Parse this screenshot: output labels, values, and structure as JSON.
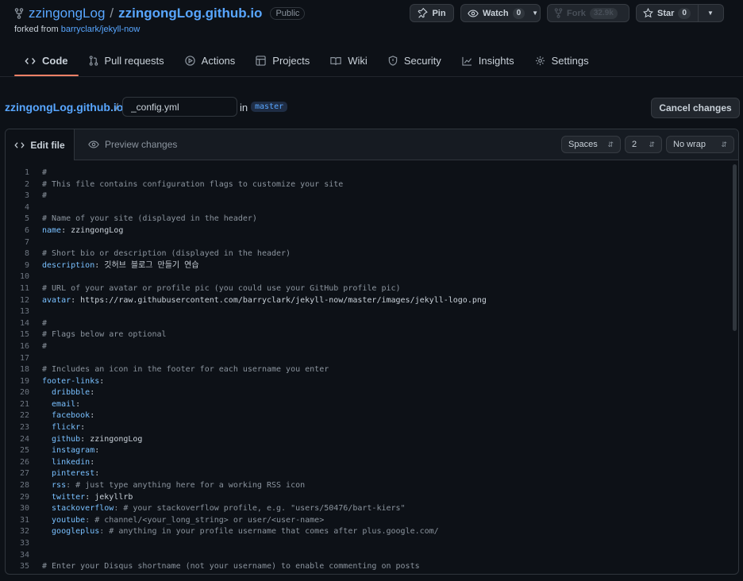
{
  "repo": {
    "owner": "zzingongLog",
    "name": "zzingongLog.github.io",
    "visibility": "Public",
    "forked_prefix": "forked from",
    "forked_source": "barryclark/jekyll-now"
  },
  "actions": {
    "pin": "Pin",
    "watch": "Watch",
    "watch_count": "0",
    "fork": "Fork",
    "fork_count": "32.9k",
    "star": "Star",
    "star_count": "0"
  },
  "tabs": [
    {
      "label": "Code",
      "icon": "code-icon"
    },
    {
      "label": "Pull requests",
      "icon": "git-pull-request-icon"
    },
    {
      "label": "Actions",
      "icon": "play-icon"
    },
    {
      "label": "Projects",
      "icon": "table-icon"
    },
    {
      "label": "Wiki",
      "icon": "book-icon"
    },
    {
      "label": "Security",
      "icon": "shield-icon"
    },
    {
      "label": "Insights",
      "icon": "graph-icon"
    },
    {
      "label": "Settings",
      "icon": "gear-icon"
    }
  ],
  "path": {
    "repo_link": "zzingongLog.github.io",
    "separator": "/",
    "filename": "_config.yml",
    "in_label": "in",
    "branch": "master",
    "cancel": "Cancel changes"
  },
  "editor": {
    "edit_tab": "Edit file",
    "preview_tab": "Preview changes",
    "indent_mode": "Spaces",
    "indent_size": "2",
    "wrap_mode": "No wrap",
    "lines": [
      {
        "n": "1",
        "parts": [
          {
            "t": "#",
            "c": "comment"
          }
        ]
      },
      {
        "n": "2",
        "parts": [
          {
            "t": "# This file contains configuration flags to customize your site",
            "c": "comment"
          }
        ]
      },
      {
        "n": "3",
        "parts": [
          {
            "t": "#",
            "c": "comment"
          }
        ]
      },
      {
        "n": "4",
        "parts": []
      },
      {
        "n": "5",
        "parts": [
          {
            "t": "# Name of your site (displayed in the header)",
            "c": "comment"
          }
        ]
      },
      {
        "n": "6",
        "parts": [
          {
            "t": "name",
            "c": "key"
          },
          {
            "t": ": zzingongLog",
            "c": "txt"
          }
        ]
      },
      {
        "n": "7",
        "parts": []
      },
      {
        "n": "8",
        "parts": [
          {
            "t": "# Short bio or description (displayed in the header)",
            "c": "comment"
          }
        ]
      },
      {
        "n": "9",
        "parts": [
          {
            "t": "description",
            "c": "key"
          },
          {
            "t": ": 깃허브 블로그 만들기 연습",
            "c": "txt"
          }
        ]
      },
      {
        "n": "10",
        "parts": []
      },
      {
        "n": "11",
        "parts": [
          {
            "t": "# URL of your avatar or profile pic (you could use your GitHub profile pic)",
            "c": "comment"
          }
        ]
      },
      {
        "n": "12",
        "parts": [
          {
            "t": "avatar",
            "c": "key"
          },
          {
            "t": ": https://raw.githubusercontent.com/barryclark/jekyll-now/master/images/jekyll-logo.png",
            "c": "txt"
          }
        ]
      },
      {
        "n": "13",
        "parts": []
      },
      {
        "n": "14",
        "parts": [
          {
            "t": "#",
            "c": "comment"
          }
        ]
      },
      {
        "n": "15",
        "parts": [
          {
            "t": "# Flags below are optional",
            "c": "comment"
          }
        ]
      },
      {
        "n": "16",
        "parts": [
          {
            "t": "#",
            "c": "comment"
          }
        ]
      },
      {
        "n": "17",
        "parts": []
      },
      {
        "n": "18",
        "parts": [
          {
            "t": "# Includes an icon in the footer for each username you enter",
            "c": "comment"
          }
        ]
      },
      {
        "n": "19",
        "parts": [
          {
            "t": "footer-links",
            "c": "key"
          },
          {
            "t": ":",
            "c": "txt"
          }
        ]
      },
      {
        "n": "20",
        "parts": [
          {
            "t": "  dribbble",
            "c": "key"
          },
          {
            "t": ":",
            "c": "txt"
          }
        ]
      },
      {
        "n": "21",
        "parts": [
          {
            "t": "  email",
            "c": "key"
          },
          {
            "t": ":",
            "c": "txt"
          }
        ]
      },
      {
        "n": "22",
        "parts": [
          {
            "t": "  facebook",
            "c": "key"
          },
          {
            "t": ":",
            "c": "txt"
          }
        ]
      },
      {
        "n": "23",
        "parts": [
          {
            "t": "  flickr",
            "c": "key"
          },
          {
            "t": ":",
            "c": "txt"
          }
        ]
      },
      {
        "n": "24",
        "parts": [
          {
            "t": "  github",
            "c": "key"
          },
          {
            "t": ": zzingongLog",
            "c": "txt"
          }
        ]
      },
      {
        "n": "25",
        "parts": [
          {
            "t": "  instagram",
            "c": "key"
          },
          {
            "t": ":",
            "c": "txt"
          }
        ]
      },
      {
        "n": "26",
        "parts": [
          {
            "t": "  linkedin",
            "c": "key"
          },
          {
            "t": ":",
            "c": "txt"
          }
        ]
      },
      {
        "n": "27",
        "parts": [
          {
            "t": "  pinterest",
            "c": "key"
          },
          {
            "t": ":",
            "c": "txt"
          }
        ]
      },
      {
        "n": "28",
        "parts": [
          {
            "t": "  rss",
            "c": "key"
          },
          {
            "t": ": # just type anything here for a working RSS icon",
            "c": "comment"
          }
        ]
      },
      {
        "n": "29",
        "parts": [
          {
            "t": "  twitter",
            "c": "key"
          },
          {
            "t": ": jekyllrb",
            "c": "txt"
          }
        ]
      },
      {
        "n": "30",
        "parts": [
          {
            "t": "  stackoverflow",
            "c": "key"
          },
          {
            "t": ": # your stackoverflow profile, e.g. \"users/50476/bart-kiers\"",
            "c": "comment"
          }
        ]
      },
      {
        "n": "31",
        "parts": [
          {
            "t": "  youtube",
            "c": "key"
          },
          {
            "t": ": # channel/<your_long_string> or user/<user-name>",
            "c": "comment"
          }
        ]
      },
      {
        "n": "32",
        "parts": [
          {
            "t": "  googleplus",
            "c": "key"
          },
          {
            "t": ": # anything in your profile username that comes after plus.google.com/",
            "c": "comment"
          }
        ]
      },
      {
        "n": "33",
        "parts": []
      },
      {
        "n": "34",
        "parts": []
      },
      {
        "n": "35",
        "parts": [
          {
            "t": "# Enter your Disqus shortname (not your username) to enable commenting on posts",
            "c": "comment"
          }
        ]
      }
    ]
  },
  "colors": {
    "background": "#0d1117",
    "link": "#58a6ff",
    "tab_underline": "#f78166",
    "yaml_key": "#79c0ff",
    "comment": "#8b949e"
  }
}
